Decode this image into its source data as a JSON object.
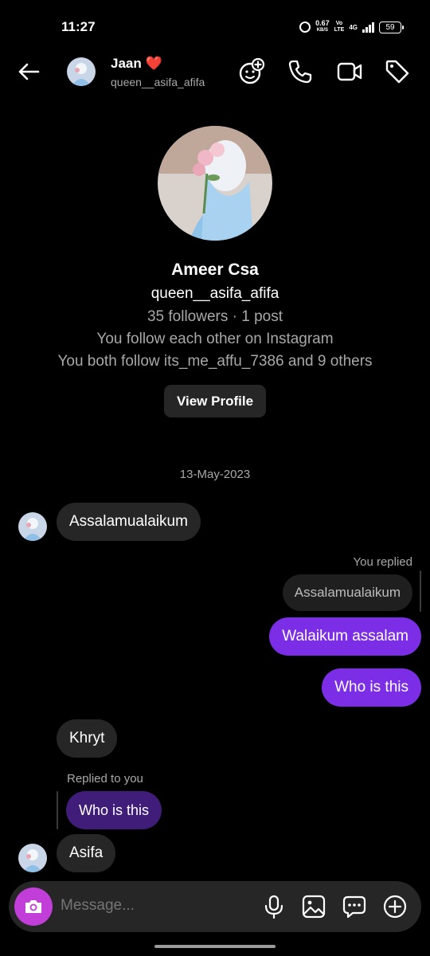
{
  "status": {
    "time": "11:27",
    "speed_value": "0.67",
    "speed_unit": "KB/S",
    "volte_top": "Vo",
    "volte_bottom": "LTE",
    "network": "4G",
    "battery": "59"
  },
  "header": {
    "name": "Jaan ❤️",
    "username": "queen__asifa_afifa"
  },
  "profile": {
    "name": "Ameer Csa",
    "handle": "queen__asifa_afifa",
    "stats": "35 followers · 1 post",
    "mutual_line": "You follow each other on Instagram",
    "common_line": "You both follow its_me_affu_7386 and 9 others",
    "view_profile_label": "View Profile"
  },
  "chat": {
    "date": "13-May-2023",
    "msg1": "Assalamualaikum",
    "you_replied_label": "You replied",
    "quoted_text": "Assalamualaikum",
    "reply1": "Walaikum assalam",
    "reply2": "Who is this",
    "msg2": "Khryt",
    "replied_to_you_label": "Replied to you",
    "quoted_reply": "Who is this",
    "msg3": "Asifa"
  },
  "composer": {
    "placeholder": "Message..."
  },
  "colors": {
    "accent": "#7b2ee6",
    "camera": "#c13fd8",
    "bubble_in": "#262626"
  }
}
